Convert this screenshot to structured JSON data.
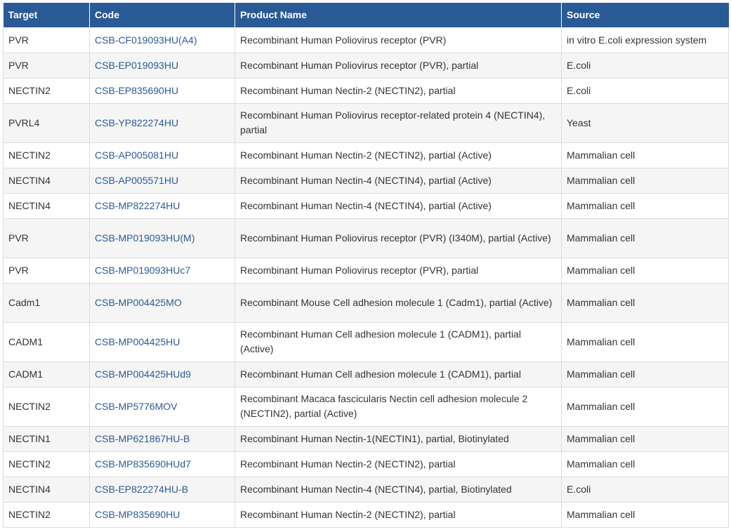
{
  "table": {
    "headers": [
      "Target",
      "Code",
      "Product Name",
      "Source"
    ],
    "rows": [
      {
        "target": "PVR",
        "code": "CSB-CF019093HU(A4)",
        "name": "Recombinant Human Poliovirus receptor (PVR)",
        "source": "in vitro E.coli expression system"
      },
      {
        "target": "PVR",
        "code": "CSB-EP019093HU",
        "name": "Recombinant Human Poliovirus receptor (PVR), partial",
        "source": "E.coli"
      },
      {
        "target": "NECTIN2",
        "code": "CSB-EP835690HU",
        "name": "Recombinant Human Nectin-2 (NECTIN2), partial",
        "source": "E.coli"
      },
      {
        "target": "PVRL4",
        "code": "CSB-YP822274HU",
        "name": "Recombinant Human Poliovirus receptor-related protein 4 (NECTIN4), partial",
        "source": "Yeast"
      },
      {
        "target": "NECTIN2",
        "code": "CSB-AP005081HU",
        "name": "Recombinant Human Nectin-2 (NECTIN2), partial (Active)",
        "source": "Mammalian cell"
      },
      {
        "target": "NECTIN4",
        "code": "CSB-AP005571HU",
        "name": "Recombinant Human Nectin-4 (NECTIN4), partial (Active)",
        "source": "Mammalian cell"
      },
      {
        "target": "NECTIN4",
        "code": "CSB-MP822274HU",
        "name": "Recombinant Human Nectin-4 (NECTIN4), partial (Active)",
        "source": "Mammalian cell"
      },
      {
        "target": "PVR",
        "code": "CSB-MP019093HU(M)",
        "name": "Recombinant Human Poliovirus receptor (PVR) (I340M), partial (Active)",
        "source": "Mammalian cell"
      },
      {
        "target": "PVR",
        "code": "CSB-MP019093HUc7",
        "name": "Recombinant Human Poliovirus receptor (PVR), partial",
        "source": "Mammalian cell"
      },
      {
        "target": "Cadm1",
        "code": "CSB-MP004425MO",
        "name": "Recombinant Mouse Cell adhesion molecule 1 (Cadm1), partial (Active)",
        "source": "Mammalian cell"
      },
      {
        "target": "CADM1",
        "code": "CSB-MP004425HU",
        "name": "Recombinant Human Cell adhesion molecule 1 (CADM1), partial (Active)",
        "source": "Mammalian cell"
      },
      {
        "target": "CADM1",
        "code": "CSB-MP004425HUd9",
        "name": "Recombinant Human Cell adhesion molecule 1 (CADM1), partial",
        "source": "Mammalian cell"
      },
      {
        "target": "NECTIN2",
        "code": "CSB-MP5776MOV",
        "name": "Recombinant Macaca fascicularis Nectin cell adhesion molecule 2 (NECTIN2), partial (Active)",
        "source": "Mammalian cell"
      },
      {
        "target": "NECTIN1",
        "code": "CSB-MP621867HU-B",
        "name": "Recombinant Human Nectin-1(NECTIN1), partial, Biotinylated",
        "source": "Mammalian cell"
      },
      {
        "target": "NECTIN2",
        "code": "CSB-MP835690HUd7",
        "name": "Recombinant Human Nectin-2 (NECTIN2), partial",
        "source": "Mammalian cell"
      },
      {
        "target": "NECTIN4",
        "code": "CSB-EP822274HU-B",
        "name": "Recombinant Human Nectin-4 (NECTIN4), partial, Biotinylated",
        "source": "E.coli"
      },
      {
        "target": "NECTIN2",
        "code": "CSB-MP835690HU",
        "name": "Recombinant Human Nectin-2 (NECTIN2), partial",
        "source": "Mammalian cell"
      }
    ]
  },
  "colors": {
    "header_bg": "#2a5a96",
    "link": "#2a5a96",
    "stripe": "#f5f5f5"
  }
}
